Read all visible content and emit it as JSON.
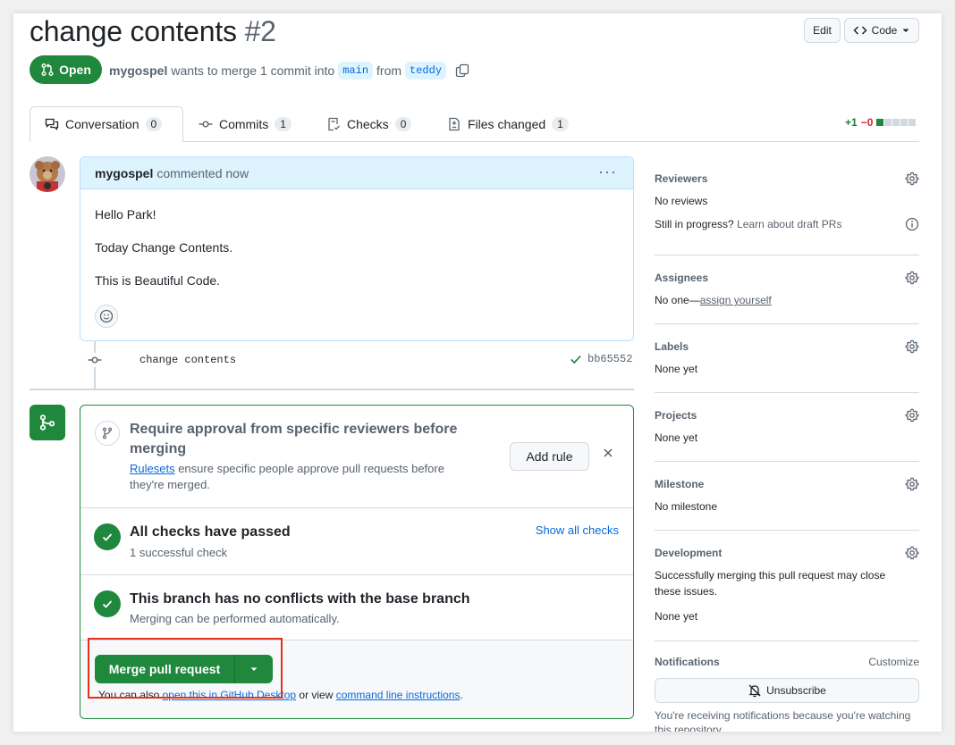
{
  "pr": {
    "title": "change contents",
    "number": "#2",
    "state": "Open",
    "author": "mygospel",
    "meta_text": "wants to merge 1 commit into",
    "base_branch": "main",
    "from_text": "from",
    "head_branch": "teddy"
  },
  "header": {
    "edit_label": "Edit",
    "code_label": "Code"
  },
  "tabs": [
    {
      "label": "Conversation",
      "count": "0"
    },
    {
      "label": "Commits",
      "count": "1"
    },
    {
      "label": "Checks",
      "count": "0"
    },
    {
      "label": "Files changed",
      "count": "1"
    }
  ],
  "diffstat": {
    "additions": "+1",
    "deletions": "−0"
  },
  "comment": {
    "author": "mygospel",
    "action": "commented now",
    "paragraphs": [
      "Hello Park!",
      "Today Change Contents.",
      "This is Beautiful Code."
    ]
  },
  "commit": {
    "message": "change contents",
    "sha": "bb65552"
  },
  "mergebox": {
    "ruleset_title": "Require approval from specific reviewers before merging",
    "ruleset_link": "Rulesets",
    "ruleset_desc": "ensure specific people approve pull requests before they're merged.",
    "add_rule_label": "Add rule",
    "checks_title": "All checks have passed",
    "checks_sub": "1 successful check",
    "show_checks_label": "Show all checks",
    "conflicts_title": "This branch has no conflicts with the base branch",
    "conflicts_sub": "Merging can be performed automatically.",
    "merge_label": "Merge pull request",
    "also_prefix": "You can also",
    "also_link1": "open this in GitHub Desktop",
    "also_mid": "or view",
    "also_link2": "command line instructions",
    "also_suffix": "."
  },
  "sidebar": {
    "reviewers": {
      "label": "Reviewers",
      "value": "No reviews",
      "progress_text": "Still in progress?",
      "progress_link": "Learn about draft PRs"
    },
    "assignees": {
      "label": "Assignees",
      "value_prefix": "No one—",
      "value_link": "assign yourself"
    },
    "labels": {
      "label": "Labels",
      "value": "None yet"
    },
    "projects": {
      "label": "Projects",
      "value": "None yet"
    },
    "milestone": {
      "label": "Milestone",
      "value": "No milestone"
    },
    "development": {
      "label": "Development",
      "desc": "Successfully merging this pull request may close these issues.",
      "value": "None yet"
    },
    "notifications": {
      "label": "Notifications",
      "customize_label": "Customize",
      "unsubscribe_label": "Unsubscribe",
      "note": "You're receiving notifications because you're watching this repository."
    }
  },
  "colors": {
    "accent_green": "#1f883d",
    "link_blue": "#0969da",
    "highlight_red": "#e5311b"
  }
}
